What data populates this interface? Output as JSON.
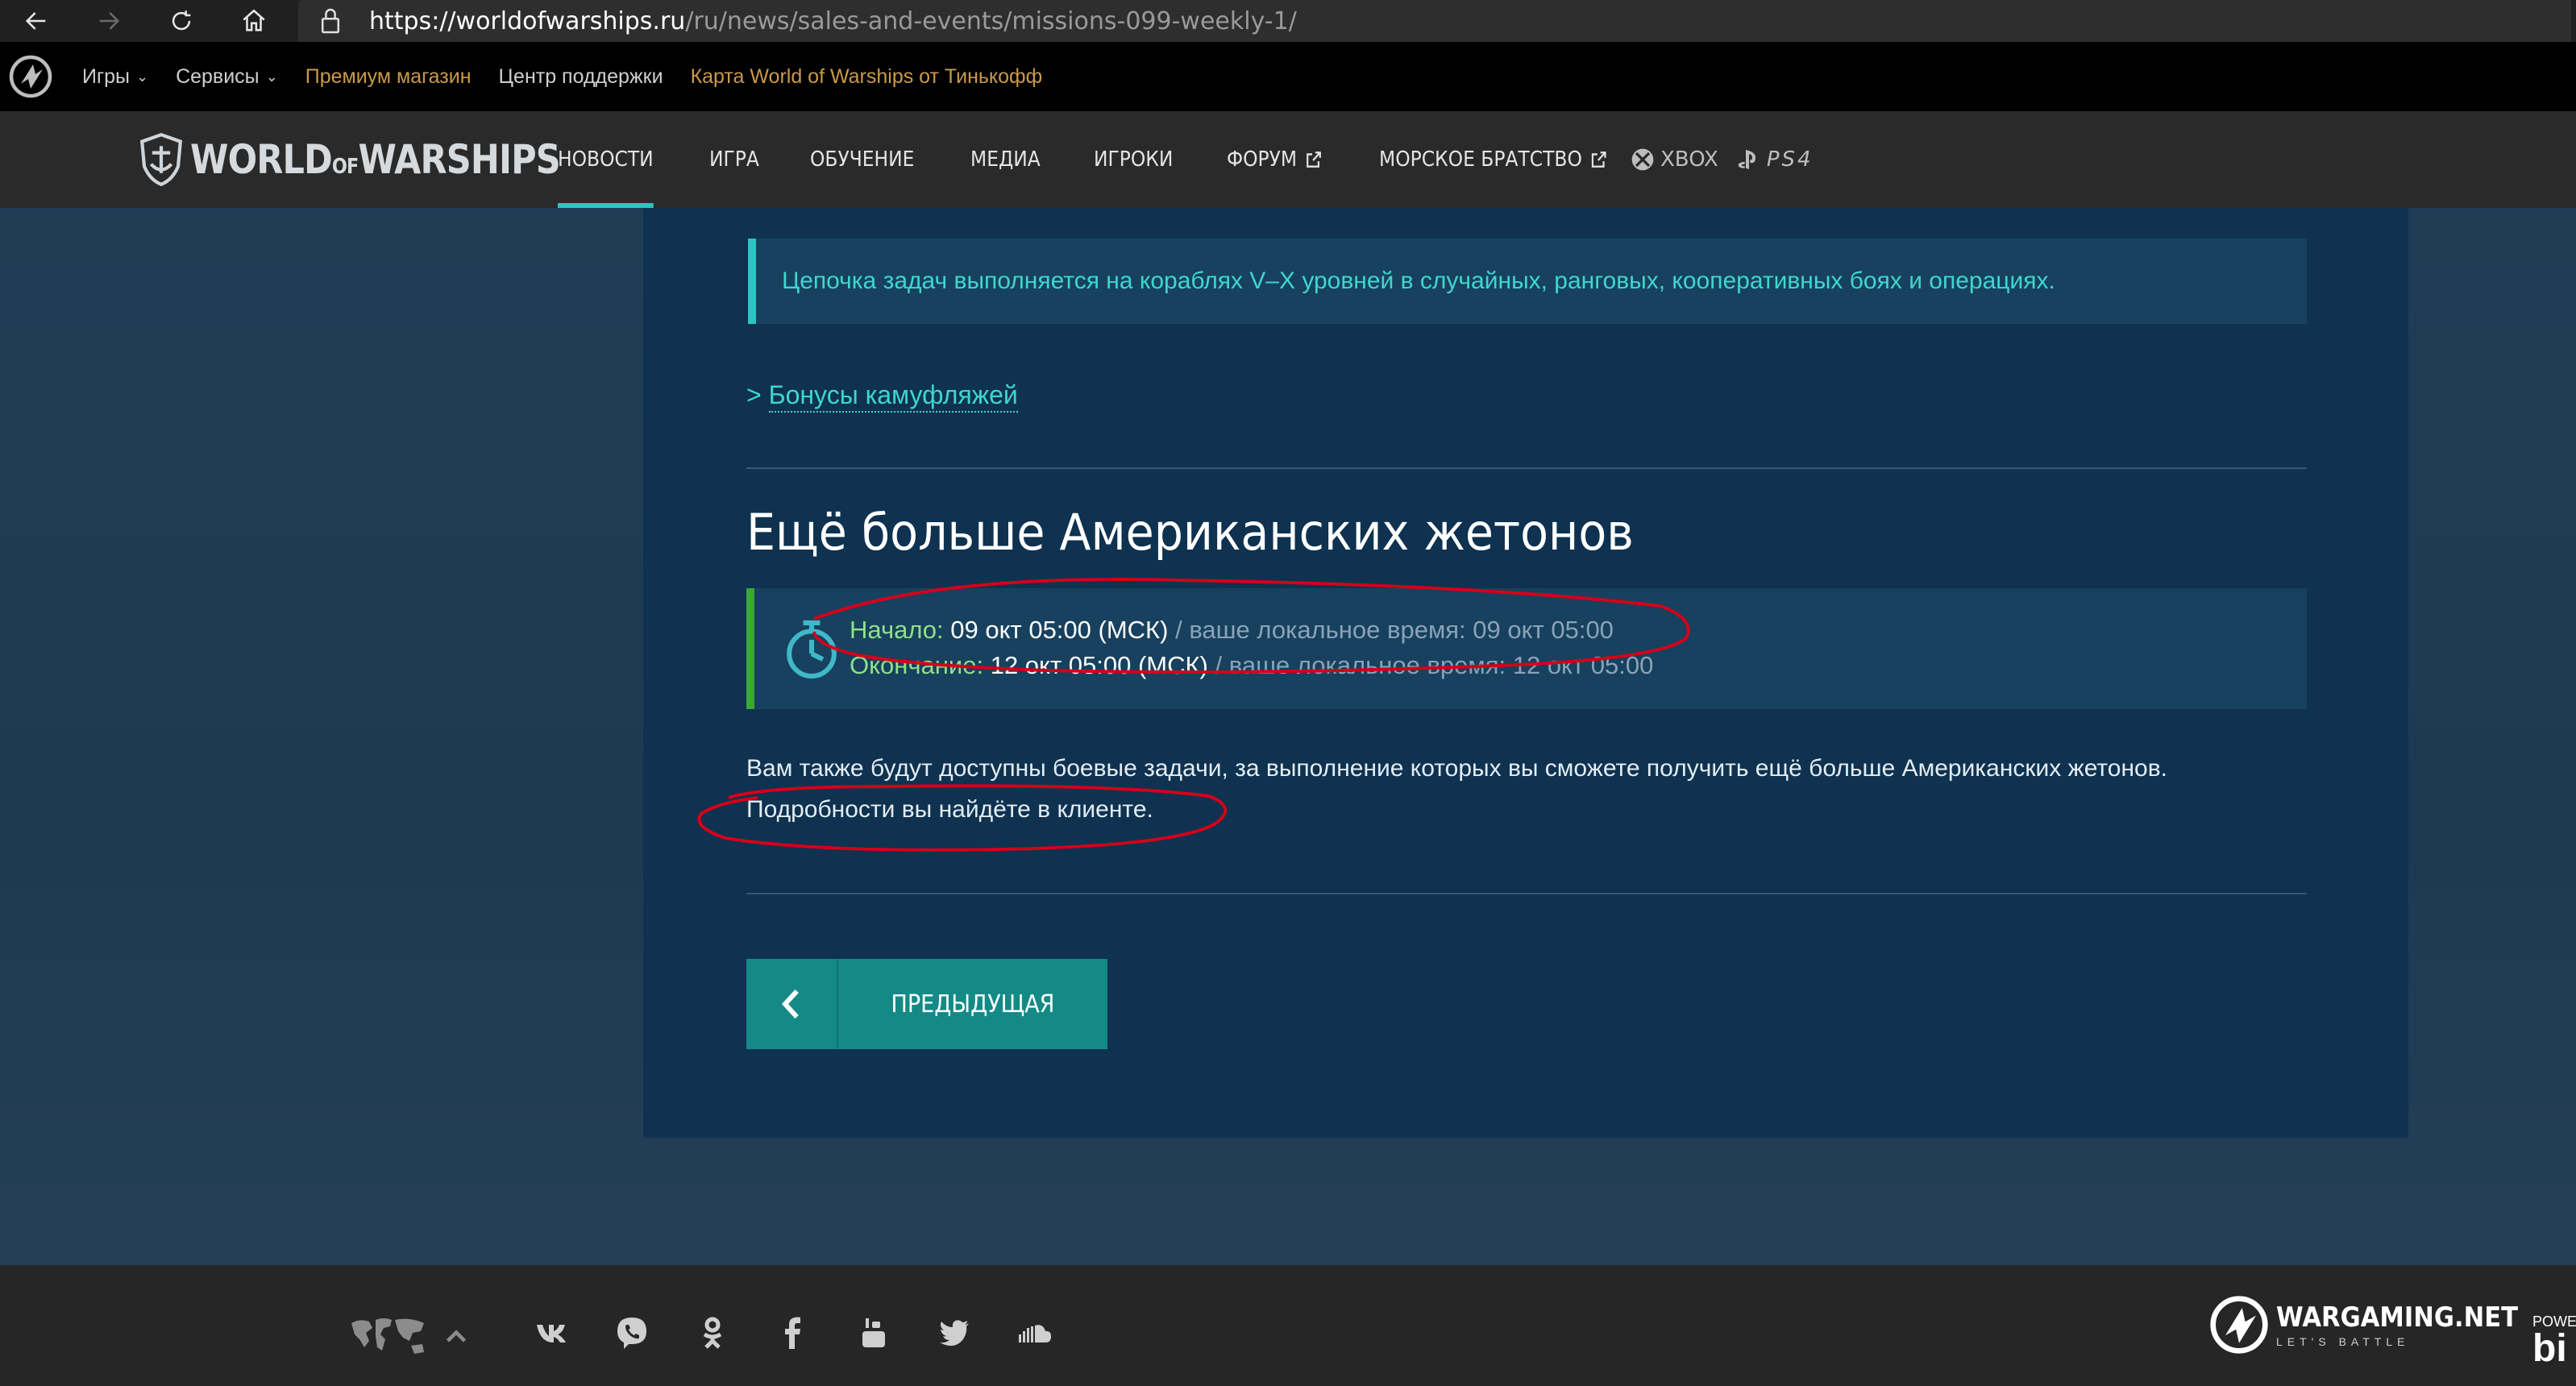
{
  "browser": {
    "url_host": "https://worldofwarships.ru",
    "url_path": "/ru/news/sales-and-events/missions-099-weekly-1/"
  },
  "wg_bar": {
    "games": "Игры",
    "services": "Сервисы",
    "premium": "Премиум магазин",
    "support": "Центр поддержки",
    "card": "Карта World of Warships от Тинькофф"
  },
  "brand": {
    "part1": "WORLD",
    "part2": "OF",
    "part3": "WARSHIPS"
  },
  "menu": {
    "news": "НОВОСТИ",
    "game": "ИГРА",
    "learn": "ОБУЧЕНИЕ",
    "media": "МЕДИА",
    "players": "ИГРОКИ",
    "forum": "ФОРУМ",
    "brotherhood": "МОРСКОЕ БРАТСТВО"
  },
  "platforms": {
    "xbox": "XBOX",
    "ps4": "PS4"
  },
  "content": {
    "notice": "Цепочка задач выполняется на кораблях V–X уровней в случайных, ранговых, кооперативных боях и операциях.",
    "bonus_arrow": ">",
    "bonus_link": "Бонусы камуфляжей",
    "section_title": "Ещё больше Американских жетонов",
    "start_label": "Начало:",
    "start_value": "09 окт 05:00 (МСК)",
    "start_local": "ваше локальное время: 09 окт 05:00",
    "end_label": "Окончание:",
    "end_value": "12 окт 05:00 (МСК)",
    "end_local": "ваше локальное время: 12 окт 05:00",
    "separator": "/",
    "paragraph": "Вам также будут доступны боевые задачи, за выполнение которых вы сможете получить ещё больше Американских жетонов. Подробности вы найдёте в клиенте.",
    "prev_button": "ПРЕДЫДУЩАЯ"
  },
  "footer": {
    "wargaming": "WARGAMING.NET",
    "tagline": "LET'S BATTLE",
    "powered": "POWE",
    "powered_logo": "bi"
  },
  "colors": {
    "accent": "#2ac6c2",
    "start_border": "#3aa836",
    "annotation": "#d4001a"
  }
}
